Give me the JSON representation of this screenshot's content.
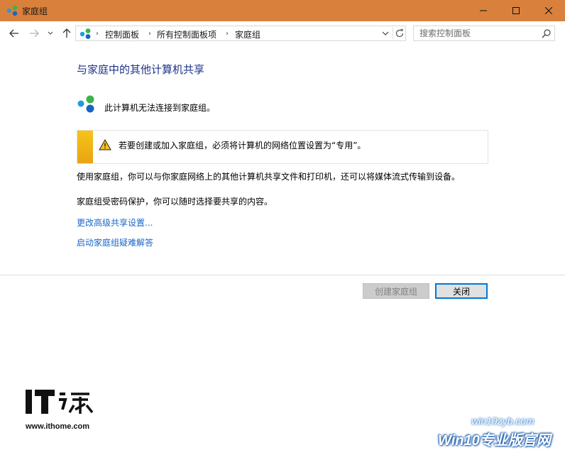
{
  "window": {
    "title": "家庭组",
    "titlebar_color": "#d9803c"
  },
  "nav": {
    "breadcrumbs": [
      "控制面板",
      "所有控制面板项",
      "家庭组"
    ],
    "search_placeholder": "搜索控制面板"
  },
  "content": {
    "heading": "与家庭中的其他计算机共享",
    "status_text": "此计算机无法连接到家庭组。",
    "warning_text": "若要创建或加入家庭组，必须将计算机的网络位置设置为“专用”。",
    "description1": "使用家庭组，你可以与你家庭网络上的其他计算机共享文件和打印机，还可以将媒体流式传输到设备。",
    "description2": "家庭组受密码保护，你可以随时选择要共享的内容。",
    "link_advanced": "更改高级共享设置...",
    "link_troubleshoot": "启动家庭组疑难解答"
  },
  "buttons": {
    "create_label": "创建家庭组",
    "close_label": "关闭"
  },
  "watermarks": {
    "ithome_url": "www.ithome.com",
    "win10_url": "win10zyb.com",
    "win10_brand": "Win10专业版官网"
  },
  "colors": {
    "accent": "#0078d7",
    "heading": "#1e3287",
    "link": "#1a66cc",
    "warning_stripe": "#f5c418"
  }
}
